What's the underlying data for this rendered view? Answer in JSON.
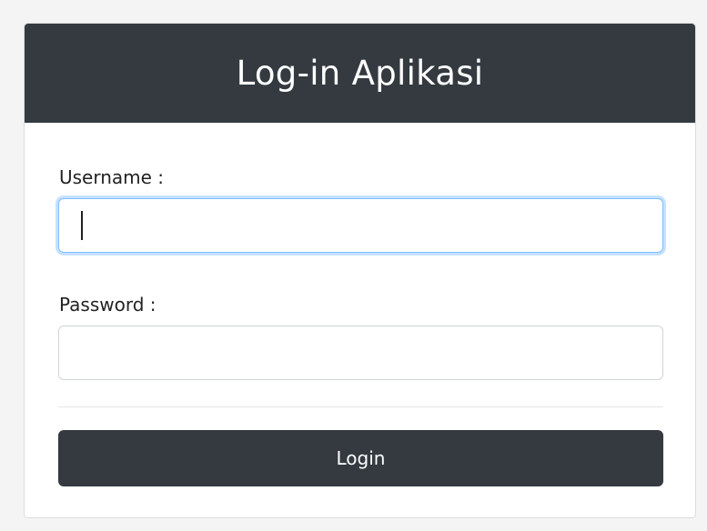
{
  "login_form": {
    "title": "Log-in Aplikasi",
    "username_label": "Username :",
    "username_value": "",
    "password_label": "Password :",
    "password_value": "",
    "submit_label": "Login"
  },
  "colors": {
    "header_bg": "#343a40",
    "button_bg": "#343a40",
    "focus_border": "#80bdff"
  }
}
